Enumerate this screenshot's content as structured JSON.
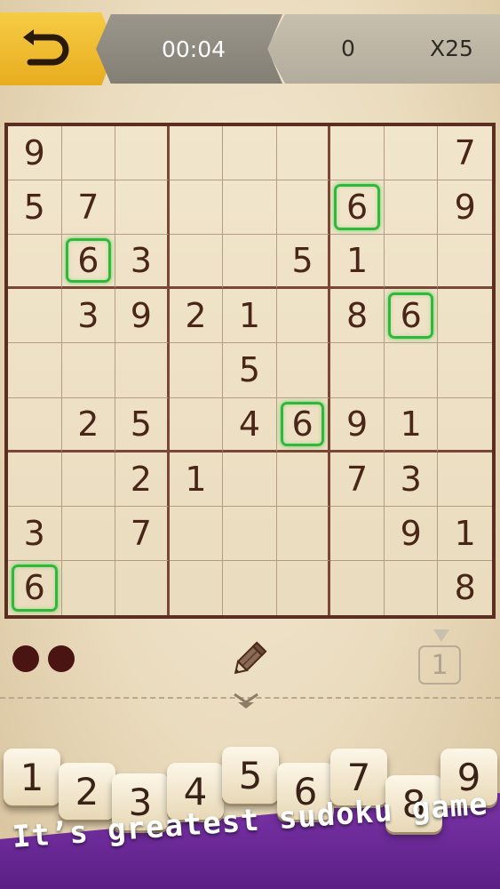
{
  "topbar": {
    "timer": "00:04",
    "score": "0",
    "multiplier": "X25",
    "colors": {
      "back_button": "#f2c13a",
      "timer_bg": "#8e8a80",
      "score_bg": "#bdb6a5"
    }
  },
  "board": {
    "cells": [
      [
        "9",
        "",
        "",
        "",
        "",
        "",
        "",
        "",
        "7"
      ],
      [
        "5",
        "7",
        "",
        "",
        "",
        "",
        "6",
        "",
        "9"
      ],
      [
        "",
        "6",
        "3",
        "",
        "",
        "5",
        "1",
        "",
        ""
      ],
      [
        "",
        "3",
        "9",
        "2",
        "1",
        "",
        "8",
        "6",
        ""
      ],
      [
        "",
        "",
        "",
        "",
        "5",
        "",
        "",
        "",
        ""
      ],
      [
        "",
        "2",
        "5",
        "",
        "4",
        "6",
        "9",
        "1",
        ""
      ],
      [
        "",
        "",
        "2",
        "1",
        "",
        "",
        "7",
        "3",
        ""
      ],
      [
        "3",
        "",
        "7",
        "",
        "",
        "",
        "",
        "9",
        "1"
      ],
      [
        "6",
        "",
        "",
        "",
        "",
        "",
        "",
        "",
        "8"
      ]
    ],
    "highlighted_digit": "6",
    "highlight_color": "#2fb83a"
  },
  "tools": {
    "mistakes_shown": 2,
    "hint_count": "1"
  },
  "numpad": {
    "keys": [
      "1",
      "2",
      "3",
      "4",
      "5",
      "6",
      "7",
      "8",
      "9"
    ]
  },
  "banner": {
    "text": "It’s greatest sudoku game ever!"
  }
}
